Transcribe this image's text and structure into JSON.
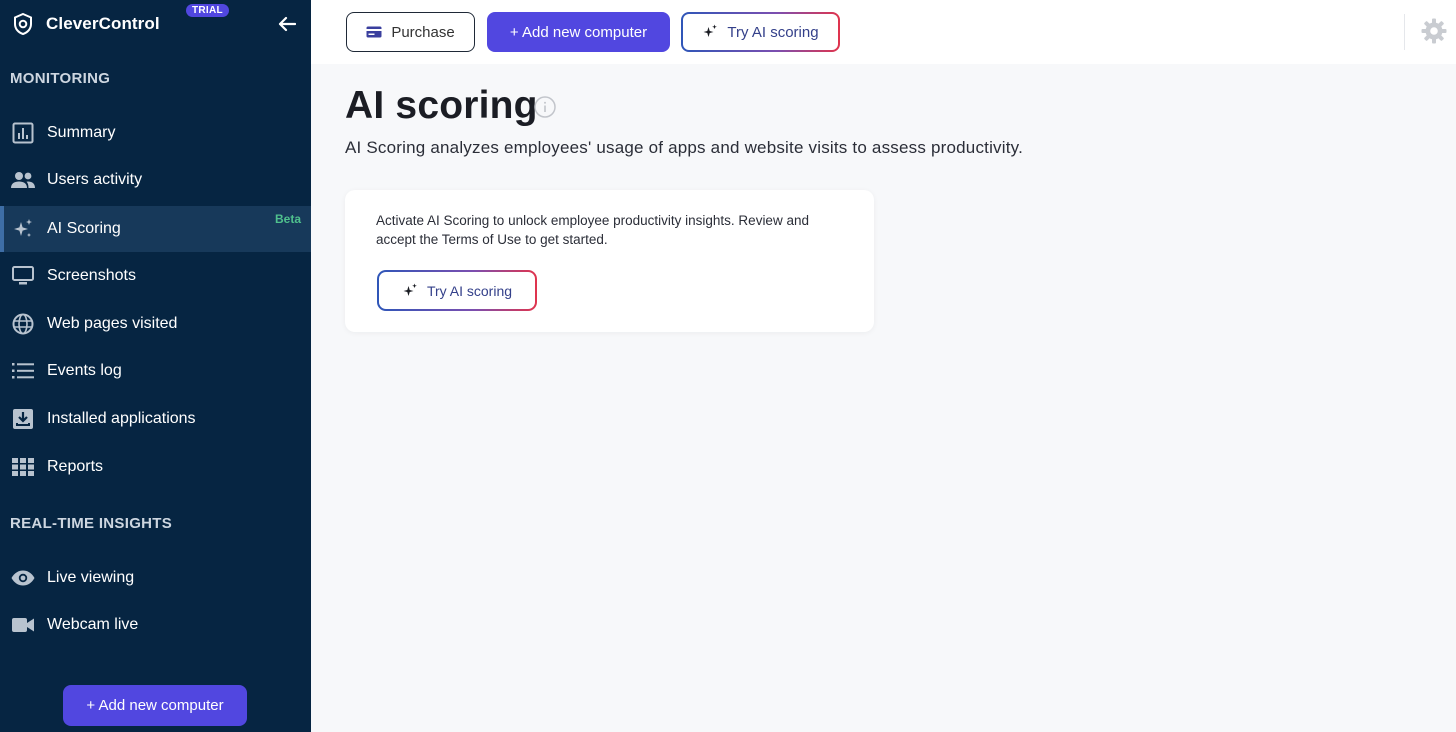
{
  "brand": {
    "name": "CleverControl",
    "badge": "TRIAL"
  },
  "sidebar": {
    "section_monitoring": "MONITORING",
    "monitoring_items": [
      {
        "label": "Summary",
        "icon": "bar-chart-icon"
      },
      {
        "label": "Users activity",
        "icon": "users-icon"
      },
      {
        "label": "AI Scoring",
        "icon": "sparkle-icon",
        "badge": "Beta",
        "active": true
      },
      {
        "label": "Screenshots",
        "icon": "monitor-icon"
      },
      {
        "label": "Web pages visited",
        "icon": "globe-icon"
      },
      {
        "label": "Events log",
        "icon": "list-icon"
      },
      {
        "label": "Installed applications",
        "icon": "download-box-icon"
      },
      {
        "label": "Reports",
        "icon": "grid-icon"
      }
    ],
    "section_realtime": "REAL-TIME INSIGHTS",
    "realtime_items": [
      {
        "label": "Live viewing",
        "icon": "eye-icon"
      },
      {
        "label": "Webcam live",
        "icon": "videocam-icon"
      }
    ],
    "add_button": "+ Add new computer"
  },
  "topbar": {
    "purchase_label": "Purchase",
    "add_label": "+ Add new computer",
    "ai_label": "Try AI scoring"
  },
  "main": {
    "title": "AI scoring",
    "subtitle": "AI Scoring analyzes employees' usage of apps and website visits to assess productivity.",
    "card": {
      "text": "Activate AI Scoring to unlock employee productivity insights. Review and accept the Terms of Use to get started.",
      "button": "Try AI scoring"
    }
  },
  "colors": {
    "sidebar_bg": "#062542",
    "accent": "#5147e0",
    "beta": "#4fc08d"
  }
}
